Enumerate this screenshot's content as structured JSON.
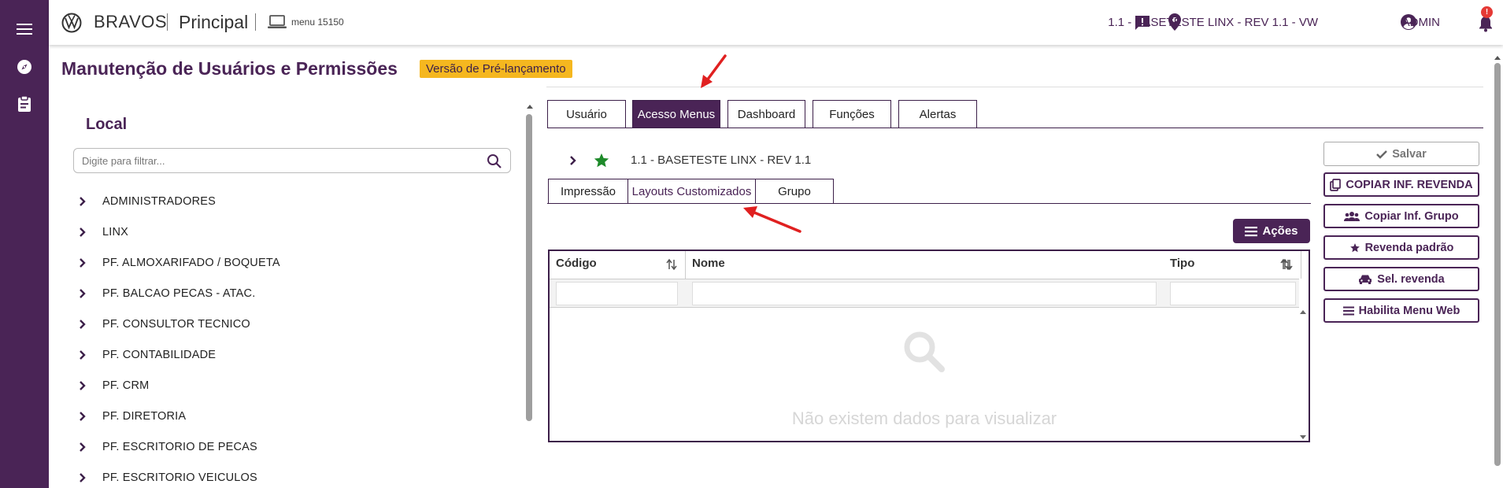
{
  "rail": {
    "items": [
      {
        "icon": "hamburger-menu-icon"
      },
      {
        "icon": "compass-icon"
      },
      {
        "icon": "clipboard-icon"
      }
    ]
  },
  "topbar": {
    "brand": "BRAVOS",
    "module": "Principal",
    "menu_code": "menu 15150",
    "revenda": "1.1 - BASETESTE LINX - REV 1.1 - VW",
    "user": "ADMIN",
    "notif_count": "!"
  },
  "page": {
    "title": "Manutenção de Usuários e Permissões",
    "badge": "Versão de Pré-lançamento"
  },
  "left": {
    "title": "Local",
    "filter_placeholder": "Digite para filtrar...",
    "items": [
      "ADMINISTRADORES",
      "LINX",
      "PF. ALMOXARIFADO / BOQUETA",
      "PF. BALCAO PECAS - ATAC.",
      "PF. CONSULTOR TECNICO",
      "PF. CONTABILIDADE",
      "PF. CRM",
      "PF. DIRETORIA",
      "PF. ESCRITORIO DE PECAS",
      "PF. ESCRITORIO VEICULOS"
    ]
  },
  "tabs": [
    "Usuário",
    "Acesso Menus",
    "Dashboard",
    "Funções",
    "Alertas"
  ],
  "tabs_active": "Acesso Menus",
  "revenda_row": {
    "label": "1.1 - BASETESTE LINX - REV 1.1"
  },
  "subtabs": [
    "Impressão",
    "Layouts Customizados",
    "Grupo"
  ],
  "subtabs_active": "Layouts Customizados",
  "actions_button": "Ações",
  "grid": {
    "columns": [
      "Código",
      "Nome",
      "Tipo"
    ],
    "empty_text": "Não existem dados para visualizar"
  },
  "right_actions": {
    "save": "Salvar",
    "copy_revenda": "COPIAR INF. REVENDA",
    "copy_group": "Copiar Inf. Grupo",
    "default_revenda": "Revenda padrão",
    "select_revenda": "Sel. revenda",
    "enable_web_menu": "Habilita Menu Web"
  },
  "colors": {
    "primary": "#4a2456",
    "badge": "#f5b71f",
    "annotation_arrow": "#e02020",
    "star": "#1e8a2a"
  }
}
